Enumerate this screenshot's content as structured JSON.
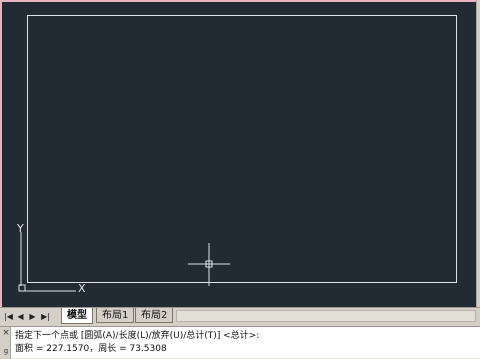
{
  "canvas": {
    "background": "#222a33",
    "ucs_y_label": "Y",
    "ucs_x_label": "X"
  },
  "layout_tabs": {
    "nav": [
      "|◀",
      "◀",
      "▶",
      "▶|"
    ],
    "tabs": [
      {
        "label": "模型",
        "active": true
      },
      {
        "label": "布局1",
        "active": false
      },
      {
        "label": "布局2",
        "active": false
      }
    ]
  },
  "command_window": {
    "close_icon": "×",
    "grip_letter": "g",
    "lines": [
      "指定下一个点或 [圆弧(A)/长度(L)/放弃(U)/总计(T)] <总计>:",
      "面积 = 227.1570，周长 = 73.5308"
    ]
  }
}
